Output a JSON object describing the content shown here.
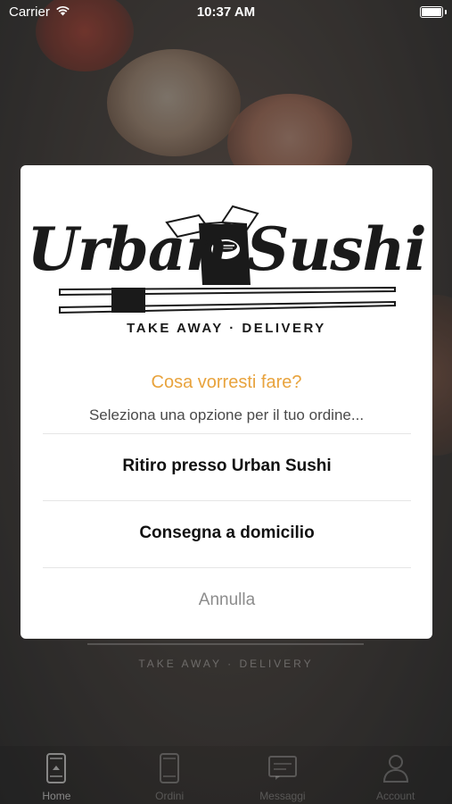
{
  "status_bar": {
    "carrier": "Carrier",
    "time": "10:37 AM"
  },
  "background": {
    "logo_tagline": "TAKE AWAY · DELIVERY"
  },
  "tab_bar": {
    "items": [
      {
        "label": "Home",
        "icon": "phone-home-icon",
        "active": true
      },
      {
        "label": "Ordini",
        "icon": "phone-orders-icon",
        "active": false
      },
      {
        "label": "Messaggi",
        "icon": "message-icon",
        "active": false
      },
      {
        "label": "Account",
        "icon": "user-icon",
        "active": false
      }
    ]
  },
  "modal": {
    "logo": {
      "brand": "Urban Sushi",
      "tagline": "TAKE AWAY · DELIVERY"
    },
    "title": "Cosa vorresti fare?",
    "subtitle": "Seleziona una opzione per il tuo ordine...",
    "options": [
      {
        "label": "Ritiro presso Urban Sushi"
      },
      {
        "label": "Consegna a domicilio"
      }
    ],
    "cancel_label": "Annulla",
    "colors": {
      "title": "#e8a33d",
      "cancel": "#8c8c8c"
    }
  }
}
